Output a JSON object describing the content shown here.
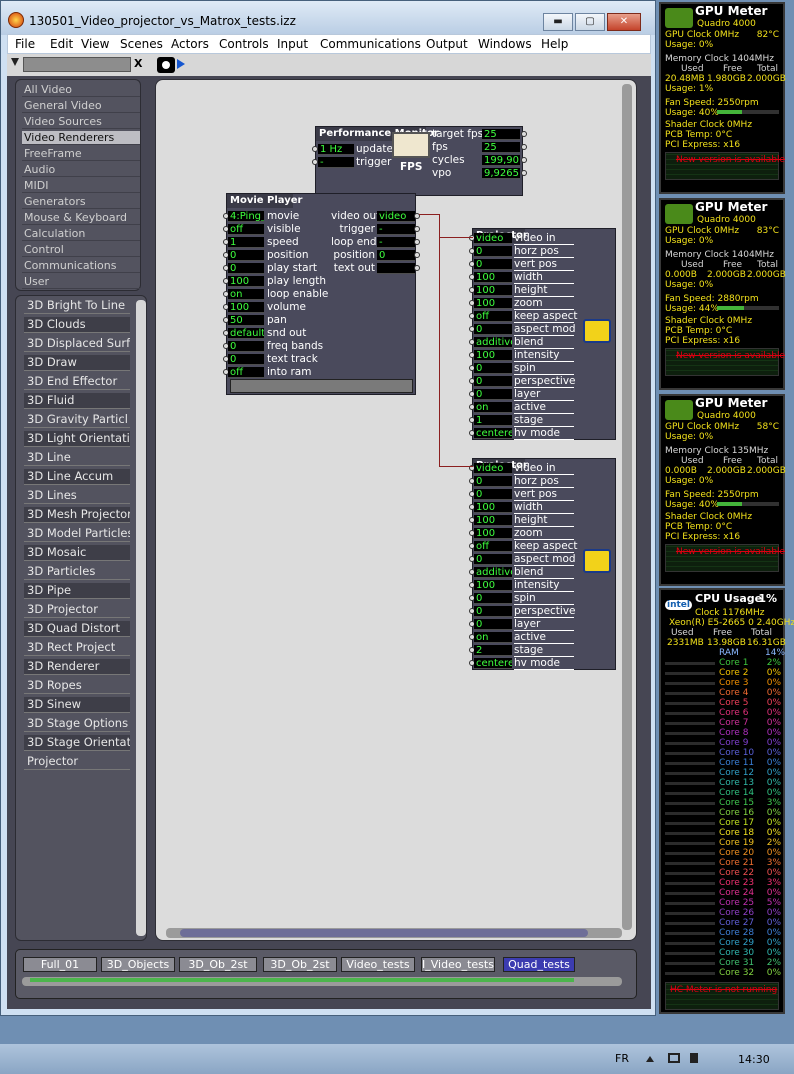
{
  "window": {
    "title": "130501_Video_projector_vs_Matrox_tests.izz",
    "min": "▬",
    "max": "▢",
    "close": "✕"
  },
  "menu": [
    "File",
    "Edit",
    "View",
    "Scenes",
    "Actors",
    "Controls",
    "Input",
    "Communications",
    "Output",
    "Windows",
    "Help"
  ],
  "toolbar": {
    "clear": "X"
  },
  "categories": [
    "All Video",
    "General Video",
    "Video Sources",
    "Video Renderers",
    "FreeFrame",
    "Audio",
    "MIDI",
    "Generators",
    "Mouse & Keyboard",
    "Calculation",
    "Control",
    "Communications",
    "User"
  ],
  "actors": [
    "3D Bright To Line",
    "3D Clouds",
    "3D Displaced Surf",
    "3D Draw",
    "3D End Effector",
    "3D Fluid",
    "3D Gravity Particl",
    "3D Light Orientati",
    "3D Line",
    "3D Line Accum",
    "3D Lines",
    "3D Mesh Projector",
    "3D Model Particles",
    "3D Mosaic",
    "3D Particles",
    "3D Pipe",
    "3D Projector",
    "3D Quad Distort",
    "3D Rect Project",
    "3D Renderer",
    "3D Ropes",
    "3D Sinew",
    "3D Stage Options",
    "3D Stage Orientat",
    "Projector"
  ],
  "perf": {
    "title": "Performance Monitor",
    "inputs": [
      [
        "1 Hz",
        "update"
      ],
      [
        "-",
        "trigger"
      ]
    ],
    "outputs": [
      [
        "target fps",
        "25"
      ],
      [
        "fps",
        "25"
      ],
      [
        "cycles",
        "199,90"
      ],
      [
        "vpo",
        "9,9265"
      ]
    ],
    "meter": "FPS"
  },
  "movie": {
    "title": "Movie Player",
    "inputs": [
      [
        "4:Ping_",
        "movie"
      ],
      [
        "off",
        "visible"
      ],
      [
        "1",
        "speed"
      ],
      [
        "0",
        "position"
      ],
      [
        "0",
        "play start"
      ],
      [
        "100",
        "play length"
      ],
      [
        "on",
        "loop enable"
      ],
      [
        "100",
        "volume"
      ],
      [
        "50",
        "pan"
      ],
      [
        "default",
        "snd out"
      ],
      [
        "0",
        "freq bands"
      ],
      [
        "0",
        "text track"
      ],
      [
        "off",
        "into ram"
      ]
    ],
    "outputs": [
      [
        "video out",
        "video"
      ],
      [
        "trigger",
        "-"
      ],
      [
        "loop end",
        "-"
      ],
      [
        "position",
        "0"
      ],
      [
        "text out",
        ""
      ]
    ]
  },
  "projector1": {
    "title": "Projector",
    "rows": [
      [
        "video",
        "video in"
      ],
      [
        "0",
        "horz pos"
      ],
      [
        "0",
        "vert pos"
      ],
      [
        "100",
        "width"
      ],
      [
        "100",
        "height"
      ],
      [
        "100",
        "zoom"
      ],
      [
        "off",
        "keep aspect"
      ],
      [
        "0",
        "aspect mod"
      ],
      [
        "additive",
        "blend"
      ],
      [
        "100",
        "intensity"
      ],
      [
        "0",
        "spin"
      ],
      [
        "0",
        "perspective"
      ],
      [
        "0",
        "layer"
      ],
      [
        "on",
        "active"
      ],
      [
        "1",
        "stage"
      ],
      [
        "centere",
        "hv mode"
      ]
    ]
  },
  "projector2": {
    "title": "Projector",
    "rows": [
      [
        "video",
        "video in"
      ],
      [
        "0",
        "horz pos"
      ],
      [
        "0",
        "vert pos"
      ],
      [
        "100",
        "width"
      ],
      [
        "100",
        "height"
      ],
      [
        "100",
        "zoom"
      ],
      [
        "off",
        "keep aspect"
      ],
      [
        "0",
        "aspect mod"
      ],
      [
        "additive",
        "blend"
      ],
      [
        "100",
        "intensity"
      ],
      [
        "0",
        "spin"
      ],
      [
        "0",
        "perspective"
      ],
      [
        "0",
        "layer"
      ],
      [
        "on",
        "active"
      ],
      [
        "2",
        "stage"
      ],
      [
        "centere",
        "hv mode"
      ]
    ]
  },
  "tabs": [
    "Full_01",
    "3D_Objects",
    "3D_Ob_2st",
    "3D_Ob_2st",
    "Video_tests",
    "I_Video_tests",
    "Quad_tests"
  ],
  "gpu": [
    {
      "title": "GPU Meter",
      "model": "Quadro 4000",
      "clock": "GPU Clock 0MHz",
      "temp": "82°C",
      "usage": "Usage: 0%",
      "mem": "Memory Clock 1404MHz",
      "used": "20.48MB",
      "free": "1.980GB",
      "total": "2.000GB",
      "musage": "Usage: 1%",
      "fan": "Fan Speed: 2550rpm",
      "fusage": "Usage: 40%",
      "fanpct": 0.4,
      "shader": "Shader Clock 0MHz",
      "pcb": "PCB Temp: 0°C",
      "pci": "PCI Express: x16",
      "newver": "New version is available"
    },
    {
      "title": "GPU Meter",
      "model": "Quadro 4000",
      "clock": "GPU Clock 0MHz",
      "temp": "83°C",
      "usage": "Usage: 0%",
      "mem": "Memory Clock 1404MHz",
      "used": "0.000B",
      "free": "2.000GB",
      "total": "2.000GB",
      "musage": "Usage: 0%",
      "fan": "Fan Speed: 2880rpm",
      "fusage": "Usage: 44%",
      "fanpct": 0.44,
      "shader": "Shader Clock 0MHz",
      "pcb": "PCB Temp: 0°C",
      "pci": "PCI Express: x16",
      "newver": "New version is available"
    },
    {
      "title": "GPU Meter",
      "model": "Quadro 4000",
      "clock": "GPU Clock 0MHz",
      "temp": "58°C",
      "usage": "Usage: 0%",
      "mem": "Memory Clock 135MHz",
      "used": "0.000B",
      "free": "2.000GB",
      "total": "2.000GB",
      "musage": "Usage: 0%",
      "fan": "Fan Speed: 2550rpm",
      "fusage": "Usage: 40%",
      "fanpct": 0.4,
      "shader": "Shader Clock 0MHz",
      "pcb": "PCB Temp: 0°C",
      "pci": "PCI Express: x16",
      "newver": "New version is available"
    }
  ],
  "gpuHeads": {
    "used": "Used",
    "free": "Free",
    "total": "Total"
  },
  "cpu": {
    "title": "CPU Usage",
    "pct": "1%",
    "clock": "Clock 1176MHz",
    "model": "Xeon(R) E5-2665 0 2.40GHz",
    "used": "2331MB",
    "free": "13.98GB",
    "total": "16.31GB",
    "ram": "RAM",
    "rampct": "14%",
    "logo": "intel",
    "footer": "HC Meter is not running",
    "cores": [
      [
        "Core 1",
        "2%"
      ],
      [
        "Core 2",
        "0%"
      ],
      [
        "Core 3",
        "0%"
      ],
      [
        "Core 4",
        "0%"
      ],
      [
        "Core 5",
        "0%"
      ],
      [
        "Core 6",
        "0%"
      ],
      [
        "Core 7",
        "0%"
      ],
      [
        "Core 8",
        "0%"
      ],
      [
        "Core 9",
        "0%"
      ],
      [
        "Core 10",
        "0%"
      ],
      [
        "Core 11",
        "0%"
      ],
      [
        "Core 12",
        "0%"
      ],
      [
        "Core 13",
        "0%"
      ],
      [
        "Core 14",
        "0%"
      ],
      [
        "Core 15",
        "3%"
      ],
      [
        "Core 16",
        "0%"
      ],
      [
        "Core 17",
        "0%"
      ],
      [
        "Core 18",
        "0%"
      ],
      [
        "Core 19",
        "2%"
      ],
      [
        "Core 20",
        "0%"
      ],
      [
        "Core 21",
        "3%"
      ],
      [
        "Core 22",
        "0%"
      ],
      [
        "Core 23",
        "3%"
      ],
      [
        "Core 24",
        "0%"
      ],
      [
        "Core 25",
        "5%"
      ],
      [
        "Core 26",
        "0%"
      ],
      [
        "Core 27",
        "0%"
      ],
      [
        "Core 28",
        "0%"
      ],
      [
        "Core 29",
        "0%"
      ],
      [
        "Core 30",
        "0%"
      ],
      [
        "Core 31",
        "2%"
      ],
      [
        "Core 32",
        "0%"
      ]
    ]
  },
  "taskbar": {
    "lang": "FR",
    "time": "14:30"
  }
}
